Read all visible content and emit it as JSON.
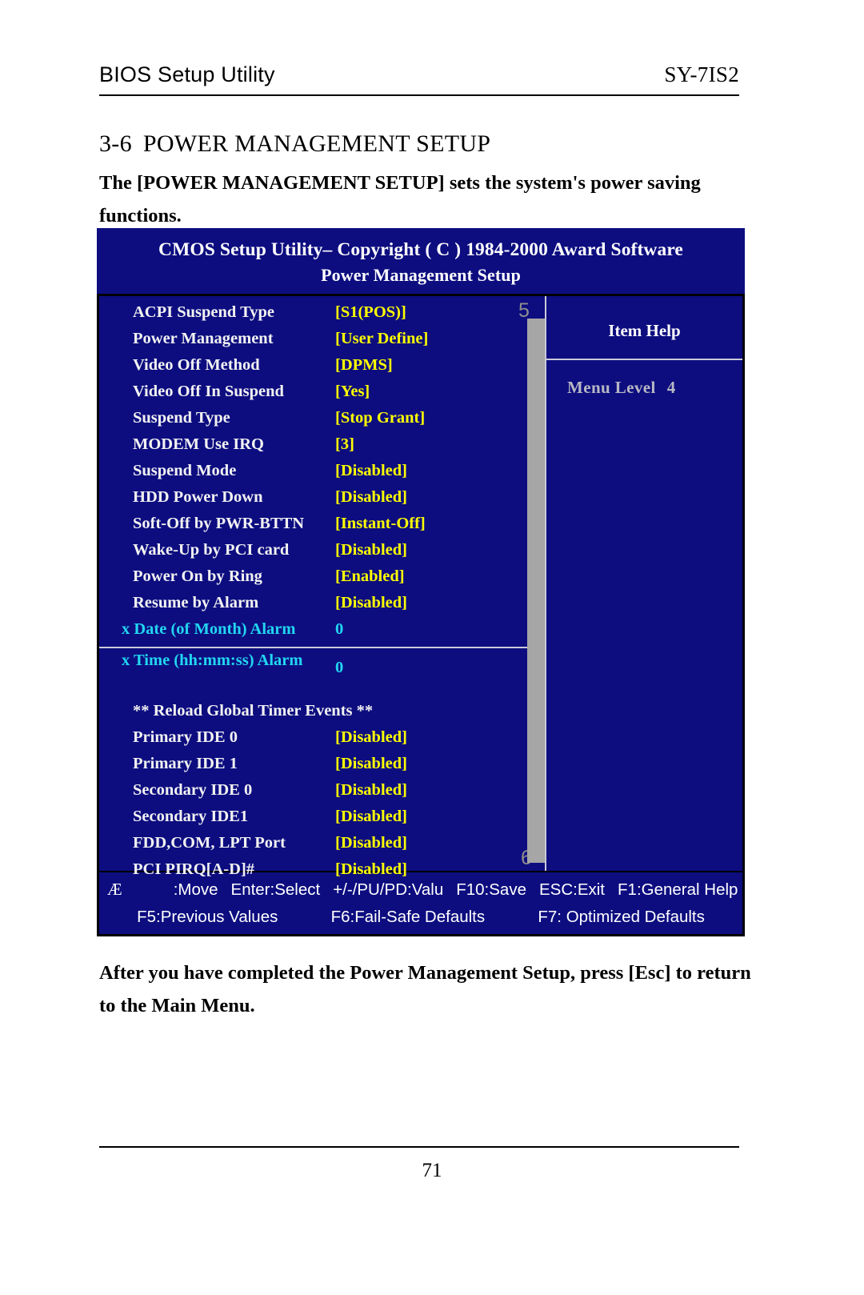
{
  "header": {
    "left": "BIOS Setup Utility",
    "right": "SY-7IS2"
  },
  "section": {
    "number": "3-6",
    "title": "POWER MANAGEMENT SETUP",
    "intro": "The [POWER MANAGEMENT SETUP] sets the system's power saving functions."
  },
  "bios": {
    "title_line1": "CMOS Setup Utility– Copyright ( C ) 1984-2000 Award Software",
    "title_line2": "Power Management Setup",
    "options": [
      {
        "label": "ACPI Suspend Type",
        "value": "[S1(POS)]"
      },
      {
        "label": "Power Management",
        "value": "[User Define]"
      },
      {
        "label": "Video Off Method",
        "value": "[DPMS]"
      },
      {
        "label": "Video Off In Suspend",
        "value": "[Yes]"
      },
      {
        "label": "Suspend Type",
        "value": "[Stop Grant]"
      },
      {
        "label": "MODEM Use IRQ",
        "value": "[3]"
      },
      {
        "label": "Suspend Mode",
        "value": "[Disabled]"
      },
      {
        "label": "HDD Power Down",
        "value": "[Disabled]"
      },
      {
        "label": "Soft-Off by PWR-BTTN",
        "value": "[Instant-Off]"
      },
      {
        "label": "Wake-Up by PCI card",
        "value": "[Disabled]"
      },
      {
        "label": "Power On by Ring",
        "value": "[Enabled]"
      },
      {
        "label": "Resume by Alarm",
        "value": "[Disabled]"
      }
    ],
    "alarm_date": {
      "label": "x Date (of Month) Alarm",
      "value": "0"
    },
    "alarm_time": {
      "label": "x Time (hh:mm:ss) Alarm",
      "value": "0"
    },
    "reload_heading": "** Reload Global Timer Events **",
    "timer_events": [
      {
        "label": "Primary IDE 0",
        "value": "[Disabled]"
      },
      {
        "label": "Primary IDE 1",
        "value": "[Disabled]"
      },
      {
        "label": "Secondary IDE 0",
        "value": "[Disabled]"
      },
      {
        "label": "Secondary IDE1",
        "value": "[Disabled]"
      },
      {
        "label": "FDD,COM, LPT Port",
        "value": "[Disabled]"
      },
      {
        "label": "PCI PIRQ[A-D]#",
        "value": "[Disabled]"
      }
    ],
    "help": {
      "title": "Item Help",
      "menu_level_label": "Menu Level",
      "menu_level_value": "4"
    },
    "callouts": {
      "top": "5",
      "bottom": "6"
    },
    "keybar": {
      "arrows": "Æ",
      "move": ":Move",
      "enter": "Enter:Select",
      "value": "+/-/PU/PD:Valu",
      "save": "F10:Save",
      "exit": "ESC:Exit",
      "general_help": "F1:General Help",
      "previous": "F5:Previous Values",
      "failsafe": "F6:Fail-Safe Defaults",
      "optimized": "F7: Optimized Defaults"
    },
    "colors": {
      "window_bg": "#0d0d80",
      "label": "#f2f2f2",
      "value": "#ffff00",
      "dependent": "#22d6f0",
      "scrollbar": "#a6a6a6",
      "callout": "#8e8e8e"
    }
  },
  "closing": "After you have completed the Power Management Setup, press [Esc] to return to the Main Menu.",
  "page_number": "71"
}
